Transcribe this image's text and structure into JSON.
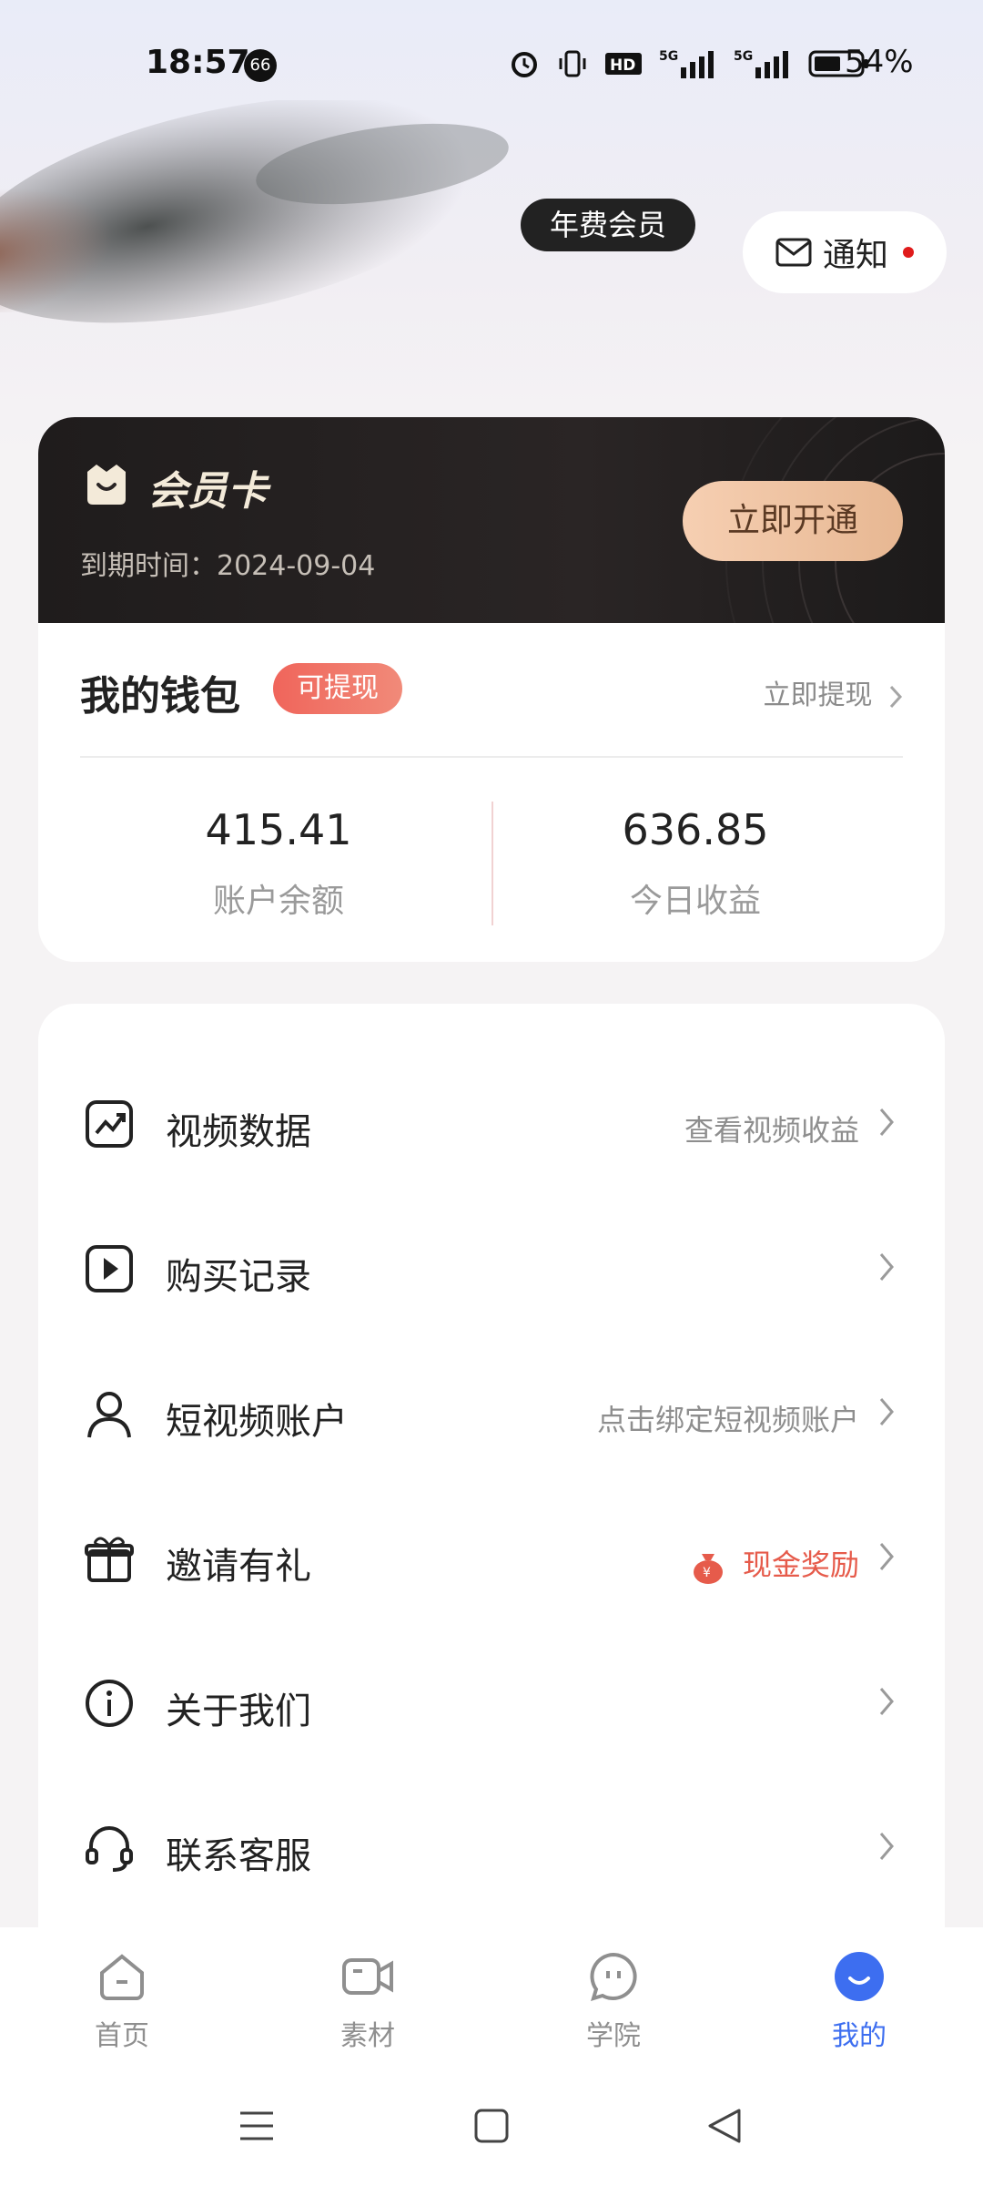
{
  "status_bar": {
    "time": "18:57",
    "notif_badge": "66",
    "battery": "54%",
    "icons": [
      "alarm-icon",
      "vibrate-icon",
      "hd-icon",
      "5g-signal-icon",
      "5g-signal-icon-2",
      "battery-icon"
    ]
  },
  "header": {
    "vip_label": "年费会员",
    "notify_label": "通知"
  },
  "member_card": {
    "title": "会员卡",
    "expiry": "到期时间：2024-09-04",
    "open_button": "立即开通"
  },
  "wallet": {
    "title": "我的钱包",
    "tag": "可提现",
    "withdraw_link": "立即提现",
    "balance_value": "415.41",
    "balance_label": "账户余额",
    "today_value": "636.85",
    "today_label": "今日收益"
  },
  "menu": [
    {
      "label": "视频数据",
      "sub": "查看视频收益",
      "icon": "chart-icon"
    },
    {
      "label": "购买记录",
      "sub": "",
      "icon": "play-icon"
    },
    {
      "label": "短视频账户",
      "sub": "点击绑定短视频账户",
      "icon": "user-icon"
    },
    {
      "label": "邀请有礼",
      "sub": "现金奖励",
      "icon": "gift-icon"
    },
    {
      "label": "关于我们",
      "sub": "",
      "icon": "info-icon"
    },
    {
      "label": "联系客服",
      "sub": "",
      "icon": "headset-icon"
    }
  ],
  "tabbar": [
    {
      "label": "首页",
      "icon": "home-icon",
      "active": false
    },
    {
      "label": "素材",
      "icon": "video-camera-icon",
      "active": false
    },
    {
      "label": "学院",
      "icon": "chat-icon",
      "active": false
    },
    {
      "label": "我的",
      "icon": "profile-icon",
      "active": true
    }
  ],
  "colors": {
    "accent": "#3d6ef0",
    "tag_red": "#f0655b",
    "card_dark": "#1f1c1c",
    "button_gold": "#f6cfb2"
  }
}
